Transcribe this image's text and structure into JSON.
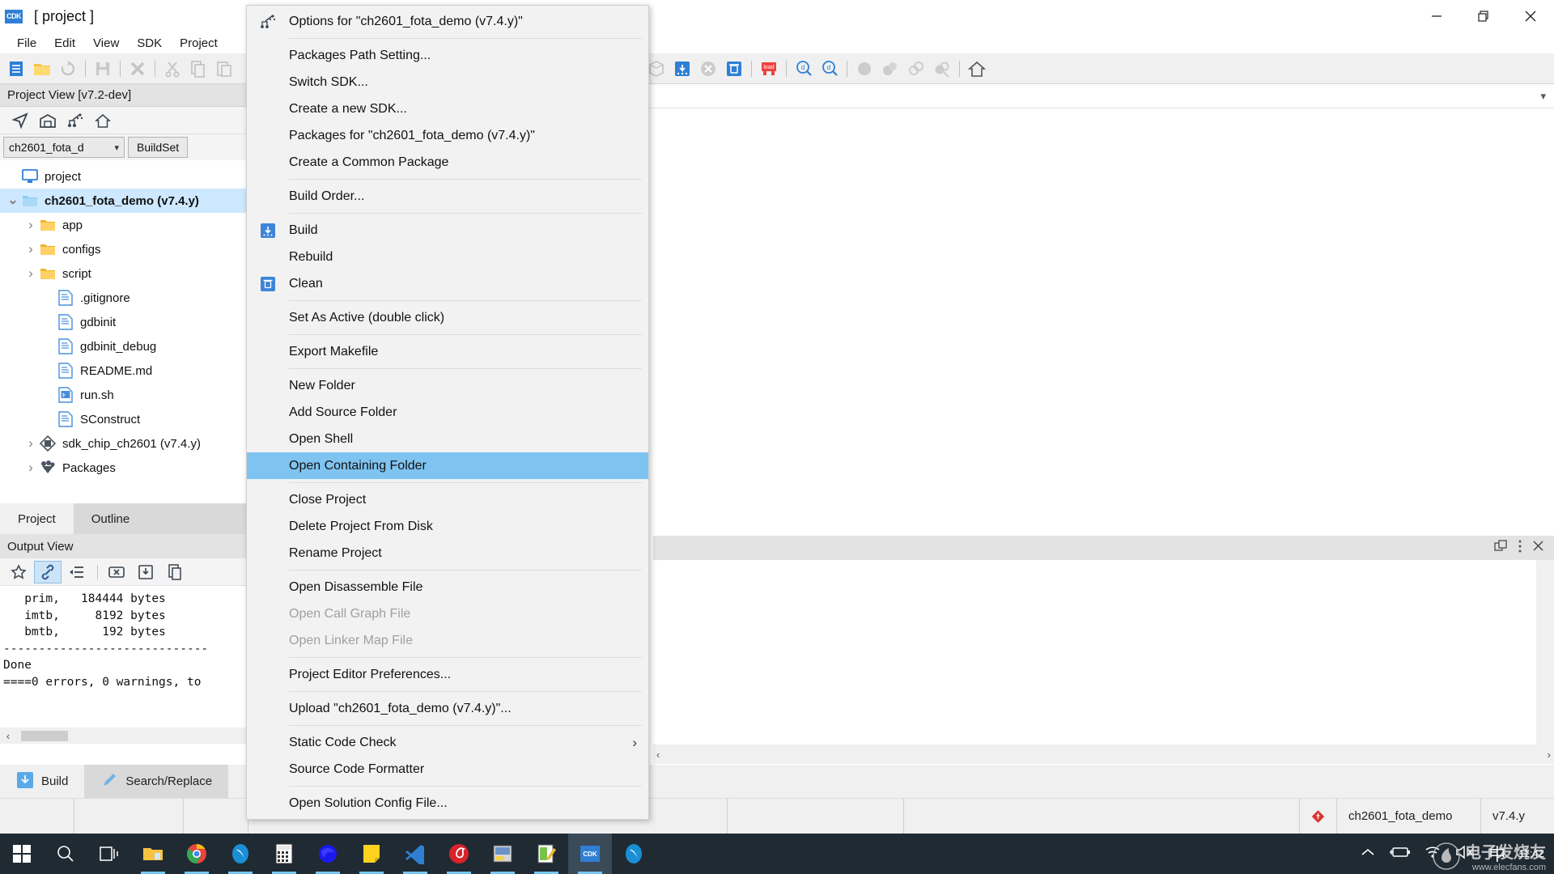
{
  "window": {
    "title": "[ project ]",
    "app_icon": "cdk-app-icon",
    "controls": {
      "minimize": "minimize-icon",
      "maximize": "restore-icon",
      "close": "close-icon"
    }
  },
  "menubar": {
    "items": [
      "File",
      "Edit",
      "View",
      "SDK",
      "Project"
    ]
  },
  "toolbar": {
    "left_icons": [
      "new-file-icon",
      "open-folder-icon",
      "refresh-icon",
      "save-icon",
      "close-x-icon",
      "cut-icon",
      "copy-icon",
      "paste-icon"
    ],
    "right_icons": [
      "flash-burn-icon",
      "package-icon",
      "build-icon",
      "stop-icon",
      "clean-icon",
      "load-icon",
      "find-icon",
      "find-next-icon",
      "debug-run-icon",
      "debug-step-icon",
      "debug-link-icon",
      "debug-unlink-icon",
      "home-icon"
    ]
  },
  "project_view": {
    "header": "Project View [v7.2-dev]",
    "toolbar_icons": [
      "locate-icon",
      "repository-icon",
      "sdk-manager-icon",
      "home-icon"
    ],
    "combo_value": "ch2601_fota_d",
    "buildset_label": "BuildSet",
    "tree": [
      {
        "label": "project",
        "icon": "workspace-icon",
        "depth": 0,
        "twisty": "",
        "selected": false
      },
      {
        "label": "ch2601_fota_demo (v7.4.y)",
        "icon": "project-folder-icon",
        "depth": 0,
        "twisty": "v",
        "selected": true
      },
      {
        "label": "app",
        "icon": "folder-icon",
        "depth": 1,
        "twisty": ">",
        "selected": false
      },
      {
        "label": "configs",
        "icon": "folder-icon",
        "depth": 1,
        "twisty": ">",
        "selected": false
      },
      {
        "label": "script",
        "icon": "folder-icon",
        "depth": 1,
        "twisty": ">",
        "selected": false
      },
      {
        "label": ".gitignore",
        "icon": "file-icon",
        "depth": 2,
        "twisty": "",
        "selected": false
      },
      {
        "label": "gdbinit",
        "icon": "file-icon",
        "depth": 2,
        "twisty": "",
        "selected": false
      },
      {
        "label": "gdbinit_debug",
        "icon": "file-icon",
        "depth": 2,
        "twisty": "",
        "selected": false
      },
      {
        "label": "README.md",
        "icon": "file-icon",
        "depth": 2,
        "twisty": "",
        "selected": false
      },
      {
        "label": "run.sh",
        "icon": "script-file-icon",
        "depth": 2,
        "twisty": "",
        "selected": false
      },
      {
        "label": "SConstruct",
        "icon": "file-icon",
        "depth": 2,
        "twisty": "",
        "selected": false
      },
      {
        "label": "sdk_chip_ch2601 (v7.4.y)",
        "icon": "chip-icon",
        "depth": 1,
        "twisty": ">",
        "selected": false
      },
      {
        "label": "Packages",
        "icon": "packages-icon",
        "depth": 1,
        "twisty": ">",
        "selected": false
      }
    ],
    "tabs": [
      {
        "label": "Project",
        "active": true
      },
      {
        "label": "Outline",
        "active": false
      }
    ]
  },
  "output_view": {
    "header": "Output View",
    "toolbar_icons": [
      "favorite-icon",
      "link-icon",
      "wrap-icon",
      "clear-icon",
      "save-output-icon",
      "copy-output-icon"
    ],
    "toolbar_selected_index": 1,
    "lines": [
      "   prim,   184444 bytes",
      "   imtb,     8192 bytes",
      "   bmtb,      192 bytes",
      "-----------------------------",
      "Done",
      "====0 errors, 0 warnings, to"
    ],
    "hscroll_left_arrow": "‹"
  },
  "bottom_tabs": [
    {
      "label": "Build",
      "icon": "build-down-icon",
      "active": false
    },
    {
      "label": "Search/Replace",
      "icon": "pencil-icon",
      "active": true
    }
  ],
  "right_panel": {
    "controls": [
      "restore-panel-icon",
      "more-options-icon",
      "close-panel-icon"
    ],
    "scroll_left": "‹",
    "scroll_right": "›"
  },
  "editor_strip": {
    "dropdown": "chevron-down-icon"
  },
  "context_menu": {
    "items": [
      {
        "label": "Options for \"ch2601_fota_demo (v7.4.y)\"",
        "icon": "sdk-options-icon",
        "state": "normal"
      },
      {
        "sep": true
      },
      {
        "label": "Packages Path Setting...",
        "icon": "",
        "state": "normal"
      },
      {
        "label": "Switch SDK...",
        "icon": "",
        "state": "normal"
      },
      {
        "label": "Create a new SDK...",
        "icon": "",
        "state": "normal"
      },
      {
        "label": "Packages for \"ch2601_fota_demo (v7.4.y)\"",
        "icon": "",
        "state": "normal"
      },
      {
        "label": "Create a Common Package",
        "icon": "",
        "state": "normal"
      },
      {
        "sep": true
      },
      {
        "label": "Build Order...",
        "icon": "",
        "state": "normal"
      },
      {
        "sep": true
      },
      {
        "label": "Build",
        "icon": "build-icon",
        "state": "normal"
      },
      {
        "label": "Rebuild",
        "icon": "",
        "state": "normal"
      },
      {
        "label": "Clean",
        "icon": "clean-icon",
        "state": "normal"
      },
      {
        "sep": true
      },
      {
        "label": "Set As Active (double click)",
        "icon": "",
        "state": "normal"
      },
      {
        "sep": true
      },
      {
        "label": "Export Makefile",
        "icon": "",
        "state": "normal"
      },
      {
        "sep": true
      },
      {
        "label": "New Folder",
        "icon": "",
        "state": "normal"
      },
      {
        "label": "Add Source Folder",
        "icon": "",
        "state": "normal"
      },
      {
        "label": "Open Shell",
        "icon": "",
        "state": "normal"
      },
      {
        "label": "Open Containing Folder",
        "icon": "",
        "state": "highlighted"
      },
      {
        "sep": true
      },
      {
        "label": "Close Project",
        "icon": "",
        "state": "normal"
      },
      {
        "label": "Delete Project From Disk",
        "icon": "",
        "state": "normal"
      },
      {
        "label": "Rename Project",
        "icon": "",
        "state": "normal"
      },
      {
        "sep": true
      },
      {
        "label": "Open Disassemble File",
        "icon": "",
        "state": "normal"
      },
      {
        "label": "Open Call Graph File",
        "icon": "",
        "state": "disabled"
      },
      {
        "label": "Open Linker Map File",
        "icon": "",
        "state": "disabled"
      },
      {
        "sep": true
      },
      {
        "label": "Project Editor Preferences...",
        "icon": "",
        "state": "normal"
      },
      {
        "sep": true
      },
      {
        "label": "Upload \"ch2601_fota_demo (v7.4.y)\"...",
        "icon": "",
        "state": "normal"
      },
      {
        "sep": true
      },
      {
        "label": "Static Code Check",
        "icon": "",
        "state": "normal",
        "submenu": true
      },
      {
        "label": "Source Code Formatter",
        "icon": "",
        "state": "normal"
      },
      {
        "sep": true
      },
      {
        "label": "Open Solution Config File...",
        "icon": "",
        "state": "normal"
      }
    ]
  },
  "statusbar": {
    "project_icon": "git-project-icon",
    "project_name": "ch2601_fota_demo",
    "version": "v7.4.y"
  },
  "taskbar": {
    "start": "windows-start-icon",
    "search": "search-icon",
    "taskview": "task-view-icon",
    "apps": [
      {
        "name": "file-explorer-icon",
        "running": true
      },
      {
        "name": "chrome-icon",
        "running": true
      },
      {
        "name": "thunderbird-icon",
        "running": true
      },
      {
        "name": "calculator-icon",
        "running": true
      },
      {
        "name": "edge-icon",
        "running": true
      },
      {
        "name": "notes-icon",
        "running": true
      },
      {
        "name": "vscode-icon",
        "running": true
      },
      {
        "name": "netease-music-icon",
        "running": true
      },
      {
        "name": "serial-tool-icon",
        "running": true
      },
      {
        "name": "editor-tool-icon",
        "running": true
      },
      {
        "name": "cdk-icon",
        "running": true,
        "active": true
      },
      {
        "name": "thunderbird2-icon",
        "running": true
      }
    ],
    "tray": [
      "chevron-up-icon",
      "battery-icon",
      "wifi-icon",
      "volume-muted-icon"
    ],
    "ime": "中",
    "clock": "11:42",
    "watermark_text": "电子发烧友",
    "watermark_sub": "www.elecfans.com"
  }
}
